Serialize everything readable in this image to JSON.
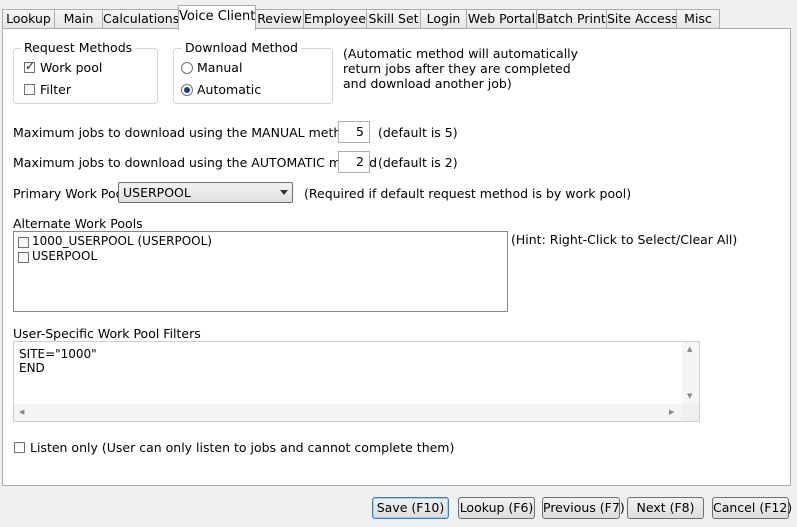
{
  "tabs": [
    {
      "label": "Lookup"
    },
    {
      "label": "Main"
    },
    {
      "label": "Calculations"
    },
    {
      "label": "Voice Client"
    },
    {
      "label": "Review"
    },
    {
      "label": "Employee"
    },
    {
      "label": "Skill Set"
    },
    {
      "label": "Login"
    },
    {
      "label": "Web Portal"
    },
    {
      "label": "Batch Print"
    },
    {
      "label": "Site Access"
    },
    {
      "label": "Misc"
    }
  ],
  "active_tab": "Voice Client",
  "request_methods": {
    "title": "Request Methods",
    "work_pool": {
      "label": "Work pool",
      "checked": true
    },
    "filter": {
      "label": "Filter",
      "checked": false
    }
  },
  "download_method": {
    "title": "Download Method",
    "manual": {
      "label": "Manual",
      "selected": false
    },
    "automatic": {
      "label": "Automatic",
      "selected": true
    }
  },
  "automatic_note": "(Automatic method will automatically return jobs after they are completed and download another job)",
  "manual_max": {
    "label": "Maximum jobs to download using the MANUAL method",
    "value": "5",
    "default": "(default is 5)"
  },
  "auto_max": {
    "label": "Maximum jobs to download using the AUTOMATIC method",
    "value": "2",
    "default": "(default is 2)"
  },
  "primary_pool": {
    "label": "Primary Work Pool",
    "value": "USERPOOL",
    "note": "(Required if default request method is by work pool)"
  },
  "alternate_pools": {
    "label": "Alternate Work Pools",
    "hint": "(Hint:  Right-Click to Select/Clear All)",
    "items": [
      {
        "label": "1000_USERPOOL  (USERPOOL)",
        "checked": false
      },
      {
        "label": "USERPOOL",
        "checked": false
      }
    ]
  },
  "filters": {
    "label": "User-Specific Work Pool Filters",
    "text": "SITE=\"1000\"\nEND"
  },
  "listen_only": {
    "label": "Listen only (User can only listen to jobs and cannot complete them)",
    "checked": false
  },
  "buttons": {
    "save": "Save (F10)",
    "lookup": "Lookup (F6)",
    "previous": "Previous (F7)",
    "next": "Next (F8)",
    "cancel": "Cancel (F12)"
  }
}
